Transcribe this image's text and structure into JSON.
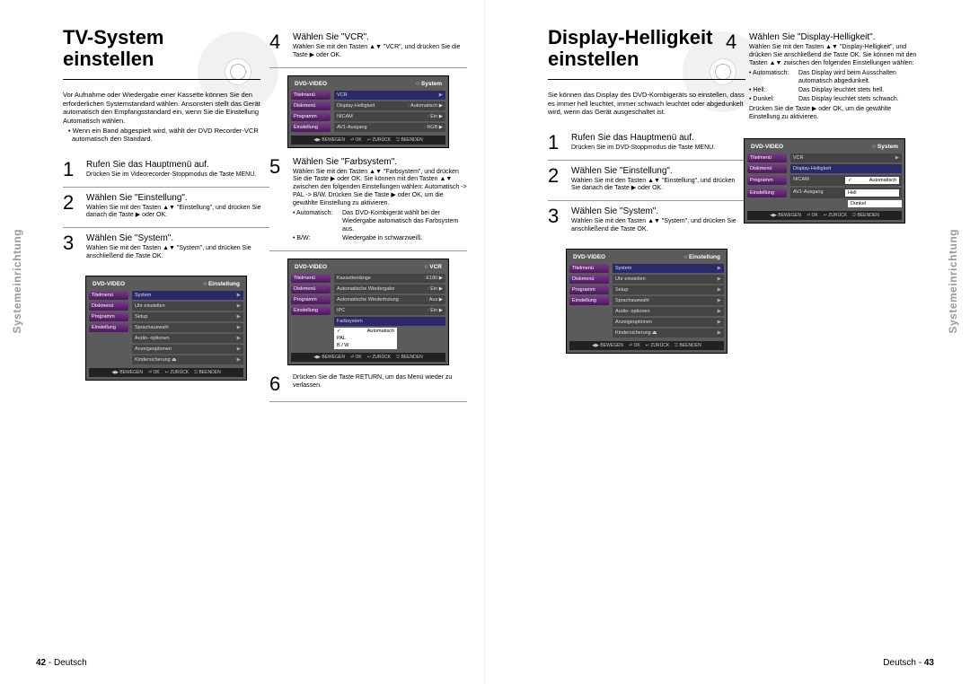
{
  "left": {
    "side_tab": "Systemeinrichtung",
    "title_l1": "TV-System",
    "title_l2": "einstellen",
    "intro_p": "Vor Aufnahme oder Wiedergabe einer Kassette können Sie den erforderlichen Systemstandard wählen. Ansonsten stellt das Gerät automatisch den Empfangsstandard ein, wenn Sie die Einstellung Automatisch wählen.",
    "intro_b1": "• Wenn ein Band abgespielt wird, wählt der DVD Recorder-VCR automatisch den Standard.",
    "s1_t": "Rufen Sie das Hauptmenü auf.",
    "s1_d": "Drücken Sie im Videorecorder-Stoppmodus die Taste MENU.",
    "s2_t": "Wählen Sie \"Einstellung\".",
    "s2_d": "Wählen Sie mit den Tasten ▲▼ \"Einstellung\", und drücken Sie danach die Taste ▶ oder OK.",
    "s3_t": "Wählen Sie \"System\".",
    "s3_d": "Wählen Sie mit den Tasten ▲▼ \"System\", und drücken Sie anschließend die Taste OK.",
    "s4_t": "Wählen Sie \"VCR\".",
    "s4_d": "Wählen Sie mit den Tasten ▲▼ \"VCR\", und drücken Sie die Taste ▶ oder OK.",
    "s5_t": "Wählen Sie \"Farbsystem\".",
    "s5_d": "Wählen Sie mit den Tasten ▲▼ \"Farbsystem\", und drücken Sie die Taste ▶ oder OK. Sie können mit den Tasten ▲▼ zwischen den folgenden Einstellungen wählen: Automatisch -> PAL -> B/W. Drücken Sie die Taste ▶ oder OK, um die gewählte Einstellung zu aktivieren.",
    "s5_b1_l": "• Automatisch:",
    "s5_b1_v": "Das DVD-Kombigerät wählt bei der Wiedergabe automatisch das Farbsystem aus.",
    "s5_b2_l": "• B/W:",
    "s5_b2_v": "Wiedergabe in schwarzweiß.",
    "s6_d": "Drücken Sie die Taste RETURN, um das Menü wieder zu verlassen.",
    "footer_num": "42",
    "footer_lang": "Deutsch",
    "osd1": {
      "hl": "DVD-VIDEO",
      "hr": "Einstellung",
      "tabs": [
        "Titelmenü",
        "Diskmenü",
        "Programm",
        "Einstellung"
      ],
      "items": [
        "System",
        "Uhr einstellen",
        "Setup",
        "Sprachauswahl",
        "Audio- optionen",
        "Anzeigeoptionen",
        "Kindersicherung ⏏"
      ],
      "footer": [
        "◀▶ BEWEGEN",
        "⏎ OK",
        "↩ ZURÜCK",
        "⎋ BEENDEN"
      ]
    },
    "osd2": {
      "hl": "DVD-VIDEO",
      "hr": "System",
      "tabs": [
        "Titelmenü",
        "Diskmenü",
        "Programm",
        "Einstellung"
      ],
      "rows": [
        {
          "k": "VCR",
          "v": ""
        },
        {
          "k": "Display-Helligkeit",
          "v": ": Automatisch ▶"
        },
        {
          "k": "NICAM",
          "v": ": Ein ▶"
        },
        {
          "k": "AV1-Ausgang",
          "v": ": RGB ▶"
        }
      ],
      "footer": [
        "◀▶ BEWEGEN",
        "⏎ OK",
        "↩ ZURÜCK",
        "⎋ BEENDEN"
      ]
    },
    "osd3": {
      "hl": "DVD-VIDEO",
      "hr": "VCR",
      "tabs": [
        "Titelmenü",
        "Diskmenü",
        "Programm",
        "Einstellung"
      ],
      "rows": [
        {
          "k": "Kassettenlänge",
          "v": ": E180 ▶"
        },
        {
          "k": "Automatische Wiedergabe",
          "v": ": Ein ▶"
        },
        {
          "k": "Automatische Wiederholung",
          "v": ": Aus ▶"
        },
        {
          "k": "IPC",
          "v": ": Ein ▶"
        },
        {
          "k": "Farbsystem",
          "v": ""
        }
      ],
      "subs": [
        "Automatisch",
        "PAL",
        "B / W"
      ],
      "footer": [
        "◀▶ BEWEGEN",
        "⏎ OK",
        "↩ ZURÜCK",
        "⎋ BEENDEN"
      ]
    }
  },
  "right": {
    "side_tab": "Systemeinrichtung",
    "title_l1": "Display-Helligkeit",
    "title_l2": "einstellen",
    "intro_p": "Sie können das Display des DVD-Kombigeräts so einstellen, dass es immer hell leuchtet, immer schwach leuchtet oder abgedunkelt wird, wenn das Gerät ausgeschaltet ist.",
    "s1_t": "Rufen Sie das Hauptmenü auf.",
    "s1_d": "Drücken Sie im DVD-Stoppmodus die Taste MENU.",
    "s2_t": "Wählen Sie \"Einstellung\".",
    "s2_d": "Wählen Sie mit den Tasten ▲▼ \"Einstellung\", und drücken Sie danach die Taste ▶ oder OK.",
    "s3_t": "Wählen Sie \"System\".",
    "s3_d": "Wählen Sie mit den Tasten ▲▼ \"System\", und drücken Sie anschließend die Taste OK.",
    "s4_t": "Wählen Sie \"Display-Helligkeit\".",
    "s4_d": "Wählen Sie mit den Tasten ▲▼ \"Display-Helligkeit\", und drücken Sie anschließend die Taste OK. Sie können mit den Tasten ▲▼ zwischen den folgenden Einstellungen wählen:",
    "s4_b1_l": "• Automatisch:",
    "s4_b1_v": "Das Display wird beim Ausschalten automatisch abgedunkelt.",
    "s4_b2_l": "• Hell:",
    "s4_b2_v": "Das Display leuchtet stets hell.",
    "s4_b3_l": "• Dunkel:",
    "s4_b3_v": "Das Display leuchtet stets schwach.",
    "s4_end": "Drücken Sie die Taste ▶ oder OK, um die gewählte Einstellung zu aktivieren.",
    "footer_num": "43",
    "footer_lang": "Deutsch",
    "osd1": {
      "hl": "DVD-VIDEO",
      "hr": "Einstellung",
      "tabs": [
        "Titelmenü",
        "Diskmenü",
        "Programm",
        "Einstellung"
      ],
      "items": [
        "System",
        "Uhr einstellen",
        "Setup",
        "Sprachauswahl",
        "Audio- optionen",
        "Anzeigeoptionen",
        "Kindersicherung ⏏"
      ],
      "footer": [
        "◀▶ BEWEGEN",
        "⏎ OK",
        "↩ ZURÜCK",
        "⎋ BEENDEN"
      ]
    },
    "osd2": {
      "hl": "DVD-VIDEO",
      "hr": "System",
      "tabs": [
        "Titelmenü",
        "Diskmenü",
        "Programm",
        "Einstellung"
      ],
      "rows": [
        {
          "k": "VCR",
          "v": ""
        },
        {
          "k": "Display-Helligkeit",
          "v": ""
        },
        {
          "k": "NICAM",
          "v": ""
        },
        {
          "k": "AV1-Ausgang",
          "v": ""
        }
      ],
      "subs": [
        "Automatisch",
        "Hell",
        "Dunkel"
      ],
      "footer": [
        "◀▶ BEWEGEN",
        "⏎ OK",
        "↩ ZURÜCK",
        "⎋ BEENDEN"
      ]
    }
  }
}
